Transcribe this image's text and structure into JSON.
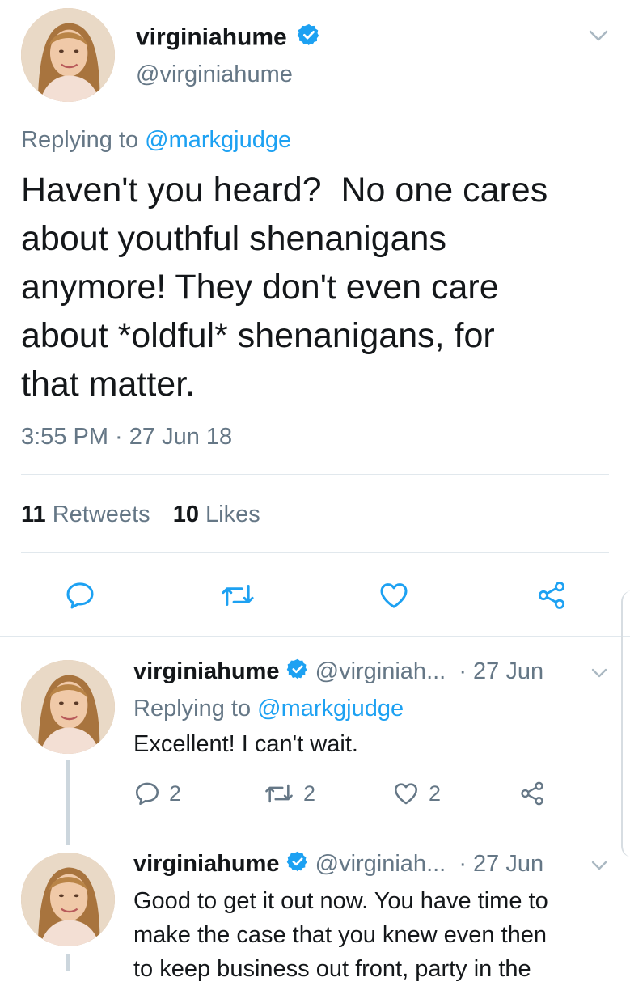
{
  "main_tweet": {
    "display_name": "virginiahume",
    "handle": "@virginiahume",
    "replying_prefix": "Replying to",
    "replying_to": "@markgjudge",
    "text_line1": "Haven't you heard?  No one cares",
    "text_line2": "about youthful shenanigans",
    "text_line3": "anymore! They don't even care",
    "text_line4": "about *oldful* shenanigans, for",
    "text_line5": "that matter.",
    "timestamp": "3:55 PM · 27 Jun 18",
    "retweets_count": "11",
    "retweets_label": "Retweets",
    "likes_count": "10",
    "likes_label": "Likes"
  },
  "replies": [
    {
      "display_name": "virginiahume",
      "handle": "@virginiah...",
      "date": "· 27 Jun",
      "replying_prefix": "Replying to",
      "replying_to": "@markgjudge",
      "text": "Excellent! I can't wait.",
      "reply_count": "2",
      "retweet_count": "2",
      "like_count": "2"
    },
    {
      "display_name": "virginiahume",
      "handle": "@virginiah...",
      "date": "· 27 Jun",
      "text_line1": "Good to get it out now. You have time to",
      "text_line2": "make the case that you knew even then",
      "text_line3": "to keep business out front, party in the"
    }
  ],
  "icons": {
    "chevron": "chevron-down-icon",
    "verified": "verified-badge-icon",
    "reply": "reply-icon",
    "retweet": "retweet-icon",
    "like": "heart-icon",
    "share": "share-icon"
  },
  "colors": {
    "brand_blue": "#1da1f2",
    "muted_gray": "#657786",
    "text_dark": "#14171a",
    "divider": "#e1e8ed"
  }
}
